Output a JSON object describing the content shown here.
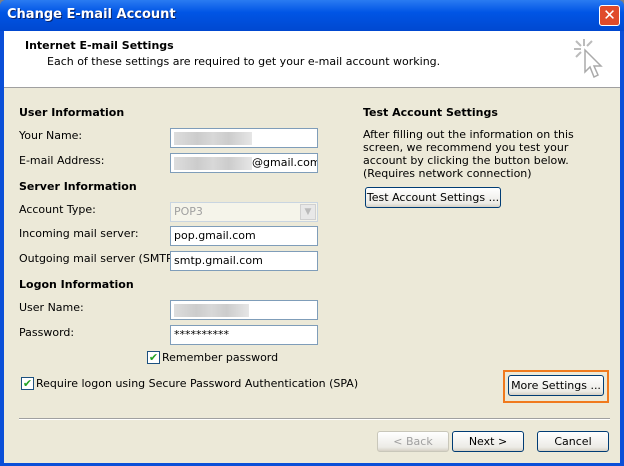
{
  "window": {
    "title": "Change E-mail Account",
    "close_icon": "close-icon"
  },
  "header": {
    "title": "Internet E-mail Settings",
    "subtitle": "Each of these settings are required to get your e-mail account working."
  },
  "user_info": {
    "heading": "User Information",
    "name_label": "Your Name:",
    "name_value": "",
    "email_label": "E-mail Address:",
    "email_value": "@gmail.com"
  },
  "server_info": {
    "heading": "Server Information",
    "account_type_label": "Account Type:",
    "account_type_value": "POP3",
    "incoming_label": "Incoming mail server:",
    "incoming_value": "pop.gmail.com",
    "outgoing_label": "Outgoing mail server (SMTP):",
    "outgoing_value": "smtp.gmail.com"
  },
  "logon_info": {
    "heading": "Logon Information",
    "username_label": "User Name:",
    "username_value": "",
    "password_label": "Password:",
    "password_value": "**********",
    "remember_label": "Remember password",
    "remember_checked": true,
    "spa_label": "Require logon using Secure Password Authentication (SPA)",
    "spa_checked": true
  },
  "test": {
    "heading": "Test Account Settings",
    "description": "After filling out the information on this screen, we recommend you test your account by clicking the button below. (Requires network connection)",
    "button": "Test Account Settings ..."
  },
  "buttons": {
    "more_settings": "More Settings ...",
    "back": "< Back",
    "next": "Next >",
    "cancel": "Cancel"
  },
  "colors": {
    "highlight": "#F07A1E",
    "titlebar": "#0055E5"
  }
}
